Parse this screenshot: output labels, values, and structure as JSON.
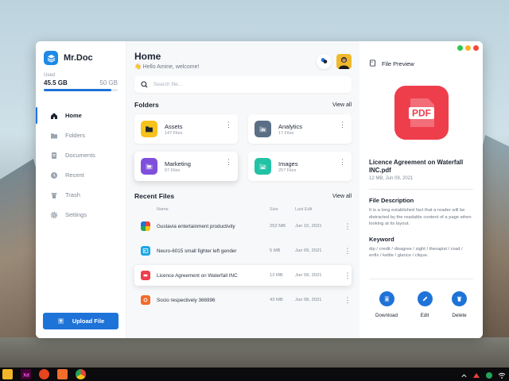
{
  "app": {
    "name": "Mr.Doc"
  },
  "storage": {
    "label": "Used",
    "used": "45.5 GB",
    "total": "50 GB",
    "fraction": 0.91
  },
  "sidebar": {
    "items": [
      {
        "label": "Home",
        "icon": "home-icon",
        "active": true
      },
      {
        "label": "Folders",
        "icon": "folder-icon"
      },
      {
        "label": "Documents",
        "icon": "document-icon"
      },
      {
        "label": "Recent",
        "icon": "clock-icon"
      },
      {
        "label": "Trash",
        "icon": "trash-icon"
      },
      {
        "label": "Settings",
        "icon": "gear-icon"
      }
    ],
    "upload_label": "Upload File"
  },
  "header": {
    "title": "Home",
    "greeting": "👋 Hello Amine, welcome!"
  },
  "search": {
    "placeholder": "Search file..."
  },
  "folders": {
    "title": "Folders",
    "view_all": "View all",
    "items": [
      {
        "name": "Assets",
        "count": "147 Files",
        "color": "#f6c21c"
      },
      {
        "name": "Analytics",
        "count": "17 Files",
        "color": "#5a6e86"
      },
      {
        "name": "Marketing",
        "count": "57 Files",
        "color": "#7f4fdc"
      },
      {
        "name": "Images",
        "count": "257 Files",
        "color": "#22c2a5"
      }
    ]
  },
  "recent": {
    "title": "Recent Files",
    "view_all": "View all",
    "columns": [
      "Name",
      "Size",
      "Last Edit"
    ],
    "rows": [
      {
        "name": "Gustavia entertainment productivity",
        "size": "252 MB",
        "date": "Jun 10, 2021",
        "color": "#e8443a"
      },
      {
        "name": "Neuro-6015 small fighter left gender",
        "size": "5 MB",
        "date": "Jun 09, 2021",
        "color": "#18a7e6"
      },
      {
        "name": "Licence Agreement on Waterfall INC",
        "size": "12 MB",
        "date": "Jun 09, 2021",
        "color": "#ee3e4c"
      },
      {
        "name": "Socio respectively 366996",
        "size": "43 MB",
        "date": "Jun 08, 2021",
        "color": "#f36a2a"
      }
    ]
  },
  "preview": {
    "header": "File Preview",
    "badge": "PDF",
    "file_title": "Licence Agreement on Waterfall INC.pdf",
    "meta": "12 MB, Jun 09, 2021",
    "desc_title": "File Description",
    "description": "It is a long established fact that a reader will be distracted by the readable content of a page when looking at its layout.",
    "keyword_title": "Keyword",
    "keywords": "dip  /  credit  /  disagree  /  sight  /  therapist  /  road  /  enfix  /  kettle  /  glance  /  clique.",
    "actions": [
      {
        "label": "Download",
        "icon": "download-icon"
      },
      {
        "label": "Edit",
        "icon": "pencil-icon"
      },
      {
        "label": "Delete",
        "icon": "trash-icon"
      }
    ]
  },
  "taskbar": {
    "apps": [
      {
        "icon": "file-explorer-icon",
        "color": "#f2b62a"
      },
      {
        "icon": "xd-icon",
        "color": "#470137",
        "text": "Xd"
      },
      {
        "icon": "app-icon",
        "color": "#e8441e"
      },
      {
        "icon": "app-icon",
        "color": "#f26c2a"
      },
      {
        "icon": "chrome-icon",
        "color": "#3b8ff0"
      }
    ]
  }
}
